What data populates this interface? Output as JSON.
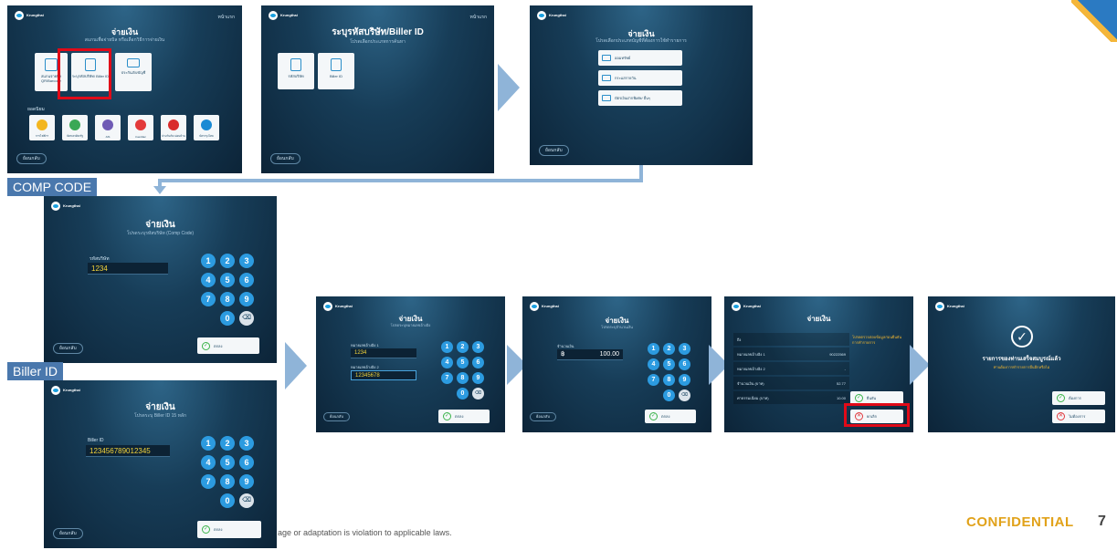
{
  "brand": {
    "name": "Krungthai",
    "sub": "กรุงไทย"
  },
  "common": {
    "home": "หน้าแรก",
    "back": "ย้อนกลับ",
    "ok": "ตกลง",
    "back_short": "ย้อนกลับ"
  },
  "screen1": {
    "title": "จ่ายเงิน",
    "subtitle": "สแกนเพื่อจ่ายบิล หรือเลือกวิธีการจ่ายเงิน",
    "tiles": [
      "สแกนจ่ายบิล QR/Barcode",
      "ระบุรหัสบริษัท/ Biller ID",
      "ประกันภัย/บัญชี"
    ],
    "section": "ยอดนิยม",
    "banks": [
      "การไฟฟ้าฯ",
      "บัตรเครดิต/รัฐ",
      "AIS",
      "true/dtac",
      "ประกันภัย/ ผ่อนบ้าน",
      "บัตรกรุงไทย"
    ]
  },
  "screen2": {
    "title": "ระบุรหัสบริษัท/Biller ID",
    "subtitle": "โปรดเลือกประเภทการค้นหา",
    "tiles": [
      "รหัสบริษัท",
      "Biller ID"
    ]
  },
  "screen3": {
    "title": "จ่ายเงิน",
    "subtitle": "โปรดเลือกประเภทบัญชีที่ต้องการใช้ทำรายการ",
    "options": [
      "ออมทรัพย์",
      "กระแสรายวัน",
      "บัตรเงินฝากพิเศษ/ อื่นๆ"
    ]
  },
  "labels": {
    "comp_code": "COMP CODE",
    "biller_id": "Biller ID"
  },
  "screen4": {
    "title": "จ่ายเงิน",
    "subtitle": "โปรดระบุรหัสบริษัท (Comp Code)",
    "field_label": "รหัสบริษัท",
    "field_value": "1234",
    "keys": [
      "1",
      "2",
      "3",
      "4",
      "5",
      "6",
      "7",
      "8",
      "9",
      "0",
      "⌫"
    ]
  },
  "screen5": {
    "title": "จ่ายเงิน",
    "subtitle": "โปรดระบุ Biller ID 15 หลัก",
    "field_label": "Biller ID",
    "field_value": "123456789012345"
  },
  "screen6": {
    "title": "จ่ายเงิน",
    "subtitle": "โปรดระบุหมายเลขอ้างอิง",
    "ref1_label": "หมายเลขอ้างอิง 1",
    "ref1_value": "1234",
    "ref2_label": "หมายเลขอ้างอิง 2",
    "ref2_value": "12345678"
  },
  "screen7": {
    "title": "จ่ายเงิน",
    "subtitle": "โปรดระบุจำนวนเงิน",
    "amount_label": "จำนวนเงิน",
    "currency": "฿",
    "amount_value": "100.00"
  },
  "screen8": {
    "title": "จ่ายเงิน",
    "rows": [
      {
        "label": "ถึง",
        "value": ""
      },
      {
        "label": "หมายเลขอ้างอิง 1",
        "value": "90222569"
      },
      {
        "label": "หมายเลขอ้างอิง 2",
        "value": "-"
      },
      {
        "label": "จำนวนเงิน (บาท)",
        "value": "52.77"
      },
      {
        "label": "ค่าธรรมเนียม (บาท)",
        "value": "10.00"
      }
    ],
    "note": "โปรดตรวจสอบข้อมูลก่อนยืนยันการทำรายการ",
    "confirm": "ยืนยัน",
    "cancel": "ยกเลิก"
  },
  "screen9": {
    "title": "รายการของท่านเสร็จสมบูรณ์แล้ว",
    "subtitle": "ท่านต้องการทำรายการอื่นอีกหรือไม่",
    "yes": "ต้องการ",
    "no": "ไม่ต้องการ"
  },
  "footer": {
    "disclaimer": "age or adaptation is violation to applicable laws.",
    "confidential": "CONFIDENTIAL",
    "page": "7"
  },
  "colors": {
    "accent": "#2c9be0",
    "arrow": "#8fb4d8",
    "highlight": "#e10a18",
    "confidential": "#e1a21a"
  }
}
